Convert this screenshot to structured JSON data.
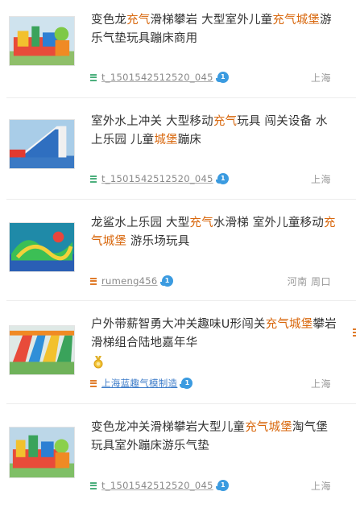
{
  "results": [
    {
      "title_parts": [
        {
          "text": "变色龙",
          "hl": false
        },
        {
          "text": "充气",
          "hl": true
        },
        {
          "text": "滑梯攀岩 大型室外儿童",
          "hl": false
        },
        {
          "text": "充气城堡",
          "hl": true
        },
        {
          "text": "游乐气垫玩具蹦床商用",
          "hl": false
        }
      ],
      "seller": "t_1501542512520_045",
      "seller_style": "gray",
      "location": "上海",
      "badge_text": "1"
    },
    {
      "title_parts": [
        {
          "text": "室外水上冲关 大型移动",
          "hl": false
        },
        {
          "text": "充气",
          "hl": true
        },
        {
          "text": "玩具 闯关设备 水上乐园 儿童",
          "hl": false
        },
        {
          "text": "城堡",
          "hl": true
        },
        {
          "text": "蹦床",
          "hl": false
        }
      ],
      "seller": "t_1501542512520_045",
      "seller_style": "gray",
      "location": "上海",
      "badge_text": "1"
    },
    {
      "title_parts": [
        {
          "text": "龙鲨水上乐园 大型",
          "hl": false
        },
        {
          "text": "充气",
          "hl": true
        },
        {
          "text": "水滑梯 室外儿童移动",
          "hl": false
        },
        {
          "text": "充气城堡",
          "hl": true
        },
        {
          "text": " 游乐场玩具",
          "hl": false
        }
      ],
      "seller": "rumeng456",
      "seller_style": "gray",
      "location": "河南 周口",
      "badge_text": "1"
    },
    {
      "title_parts": [
        {
          "text": "户外带薪智勇大冲关趣味U形闯关",
          "hl": false
        },
        {
          "text": "充气城堡",
          "hl": true
        },
        {
          "text": "攀岩滑梯组合陆地嘉年华",
          "hl": false
        }
      ],
      "seller": "上海蓝趣气模制造",
      "seller_style": "blue",
      "location": "上海",
      "badge_text": "1"
    },
    {
      "title_parts": [
        {
          "text": "变色龙冲关滑梯攀岩大型儿童",
          "hl": false
        },
        {
          "text": "充气城堡",
          "hl": true
        },
        {
          "text": "淘气堡玩具室外蹦床游乐气垫",
          "hl": false
        }
      ],
      "seller": "t_1501542512520_045",
      "seller_style": "gray",
      "location": "上海",
      "badge_text": "1"
    }
  ],
  "icons": {
    "thumbnail": "product-thumbnail",
    "shop_type": "menu-lines-icon",
    "verified": "speech-badge-icon",
    "medal": "gold-medal-icon"
  },
  "colors": {
    "highlight": "#d8660b",
    "title": "#333333",
    "seller_gray": "#888888",
    "seller_blue": "#3d7cc9",
    "location": "#999999",
    "badge": "#3b9be0",
    "shop_icon_green": "#4caf7d",
    "shop_icon_orange": "#e07b2a"
  }
}
